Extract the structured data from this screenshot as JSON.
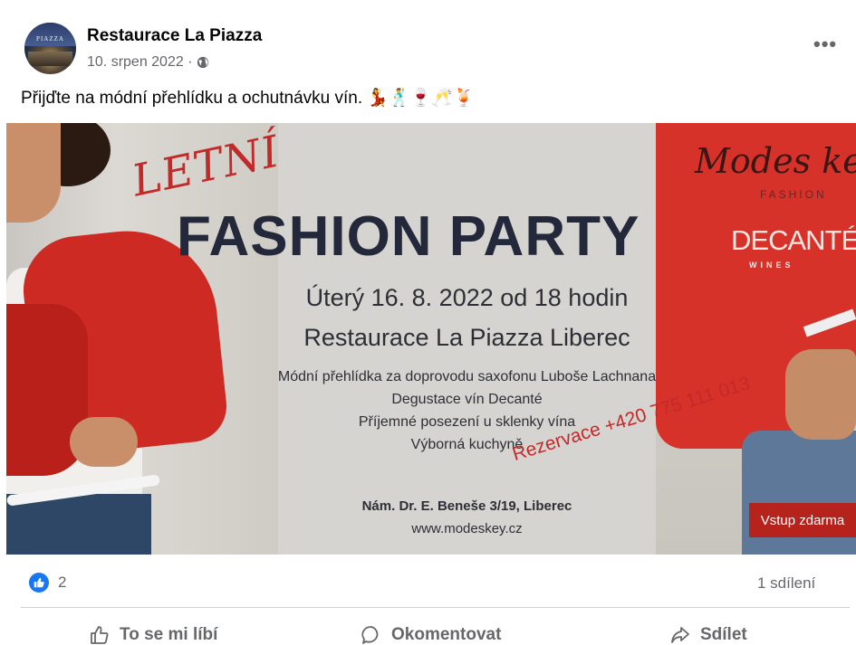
{
  "post": {
    "author": "Restaurace La Piazza",
    "avatar_text": "PIAZZA",
    "date": "10. srpen 2022 ·",
    "privacy_icon": "globe-icon",
    "more_label": "•••",
    "text": "Přijďte na módní přehlídku a ochutnávku vín. 💃🕺🍷🥂🍹"
  },
  "banner": {
    "headline_small": "LETNÍ",
    "headline": "FASHION PARTY",
    "date_line": "Úterý 16. 8. 2022 od 18 hodin",
    "venue_line": "Restaurace La Piazza Liberec",
    "program": [
      "Módní přehlídka za doprovodu saxofonu Luboše Lachnana",
      "Degustace vín Decanté",
      "Příjemné posezení u sklenky vína",
      "Výborná kuchyně"
    ],
    "reservation": "Rezervace +420 775 111 013",
    "address": "Nám. Dr. E. Beneše 3/19, Liberec",
    "website": "www.modeskey.cz",
    "entry": "Vstup zdarma",
    "brand_1": "Modes key",
    "brand_1_sub": "FASHION",
    "brand_2": "DECANTÉ",
    "brand_2_sub": "WINES"
  },
  "footer": {
    "reaction_count": "2",
    "shares": "1 sdílení",
    "actions": {
      "like": "To se mi líbí",
      "comment": "Okomentovat",
      "share": "Sdílet"
    }
  },
  "colors": {
    "facebook_blue": "#1877f2",
    "meta_gray": "#65676b",
    "banner_red": "#c22a2a"
  }
}
